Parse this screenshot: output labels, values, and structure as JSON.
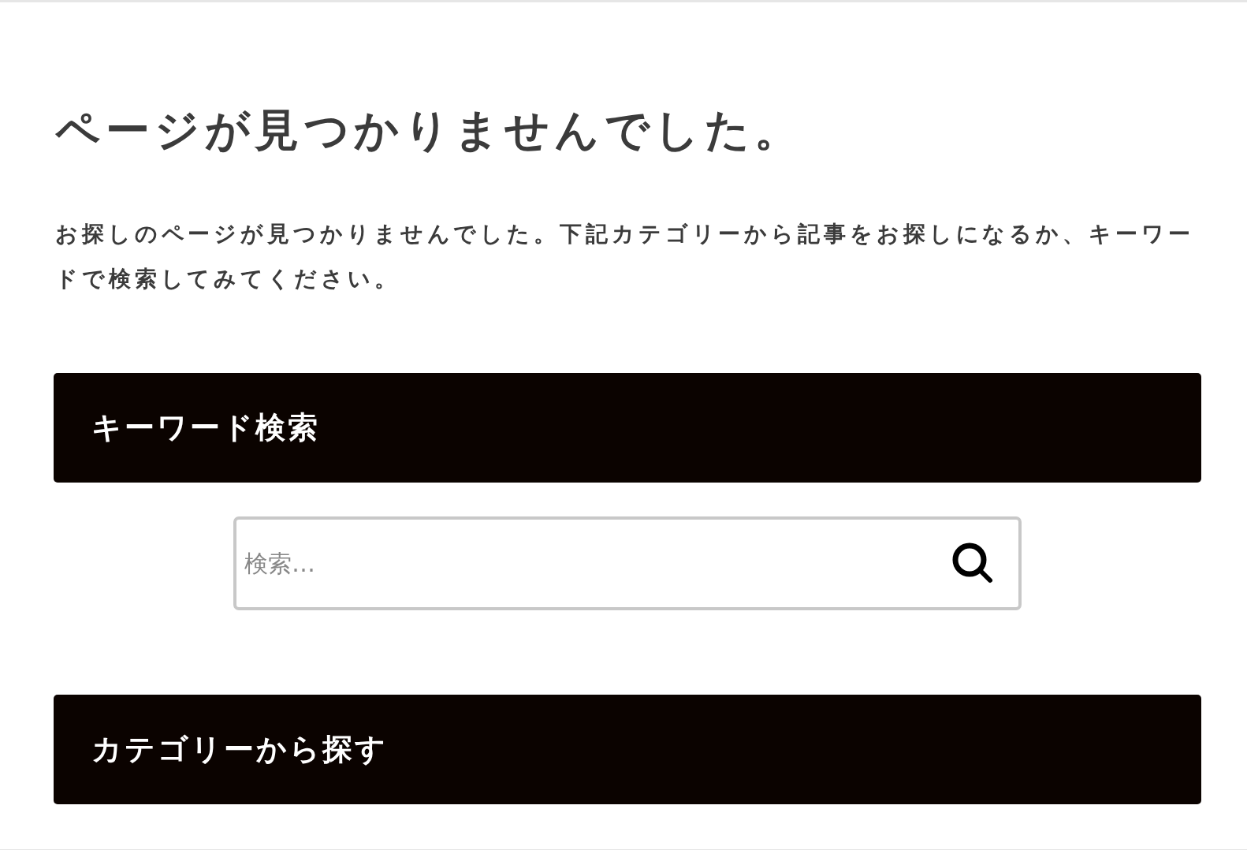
{
  "title": "ページが見つかりませんでした。",
  "message": "お探しのページが見つかりませんでした。下記カテゴリーから記事をお探しになるか、キーワードで検索してみてください。",
  "keyword_section": {
    "heading": "キーワード検索",
    "search": {
      "placeholder": "検索…"
    }
  },
  "category_section": {
    "heading": "カテゴリーから探す"
  }
}
